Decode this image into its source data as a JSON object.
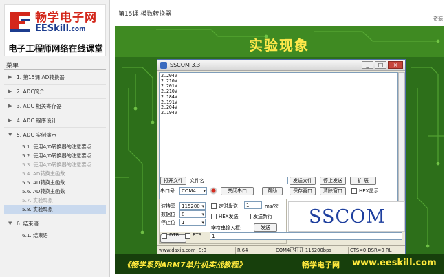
{
  "sidebar": {
    "logo": {
      "cn": "畅学电子网",
      "en_main": "EESkill",
      "en_suffix": ".com",
      "slogan": "电子工程师网络在线课堂"
    },
    "menu_header": "菜单",
    "items": [
      {
        "label": "1. 第15课 AD转换器"
      },
      {
        "label": "2. ADC简介"
      },
      {
        "label": "3. ADC 相关寄存器"
      },
      {
        "label": "4. ADC 程序设计"
      },
      {
        "label": "5. ADC 实例演示"
      }
    ],
    "sub_items": [
      {
        "label": "5.1. 使用A/D转换器的注意要点"
      },
      {
        "label": "5.2. 使用A/D转换器的注意要点"
      },
      {
        "label": "5.3. 使用A/D转换器的注意要点"
      },
      {
        "label": "5.4. AD转换主函数"
      },
      {
        "label": "5.5. AD转换主函数"
      },
      {
        "label": "5.6. AD转换主函数"
      },
      {
        "label": "5.7. 实验现象"
      },
      {
        "label": "5.8. 实验现象"
      }
    ],
    "item6": {
      "label": "6. 结束语"
    },
    "sub6": {
      "label": "6.1. 结束语"
    }
  },
  "header": {
    "title": "第15课 模数转换器",
    "util": "资源"
  },
  "slide": {
    "title": "实验现象",
    "footer_left": "《畅学系列ARM7单片机实战教程》",
    "footer_cn": "畅学电子网",
    "footer_url": "www.eeskill.com"
  },
  "sscom": {
    "title": "SSCOM 3.3",
    "buttons": {
      "minimize": "_",
      "maximize": "□",
      "close": "×"
    },
    "received": [
      "2.204V",
      "2.210V",
      "2.201V",
      "2.210V",
      "2.184V",
      "2.191V",
      "2.204V",
      "2.194V"
    ],
    "open_file": "打开文件",
    "filename_label": "文件名",
    "send_file": "发送文件",
    "stop_send": "停止发送",
    "expand": "扩 展",
    "port_label": "串口号",
    "port_value": "COM4",
    "close_port": "关闭串口",
    "help": "帮助",
    "save_window": "保存窗口",
    "clear_window": "清除窗口",
    "hex_display": "HEX显示",
    "baud_label": "波特率",
    "baud_value": "115200",
    "databits_label": "数据位",
    "databits_value": "8",
    "stopbits_label": "停止位",
    "stopbits_value": "1",
    "timed_send": "定时发送",
    "interval_value": "1",
    "interval_unit": "ms/次",
    "hex_send": "HEX发送",
    "send_newline": "发送新行",
    "input_label": "字符串输入框:",
    "send_btn": "发送",
    "input_value": "1",
    "dtr": "DTR",
    "rts": "RTS",
    "brand": "SSCOM",
    "status": {
      "site": "www.daxia.com",
      "s": "S:0",
      "r": "R:64",
      "port": "COM4已打开  115200bps",
      "lines": "CTS=0 DSR=0 RL"
    }
  }
}
